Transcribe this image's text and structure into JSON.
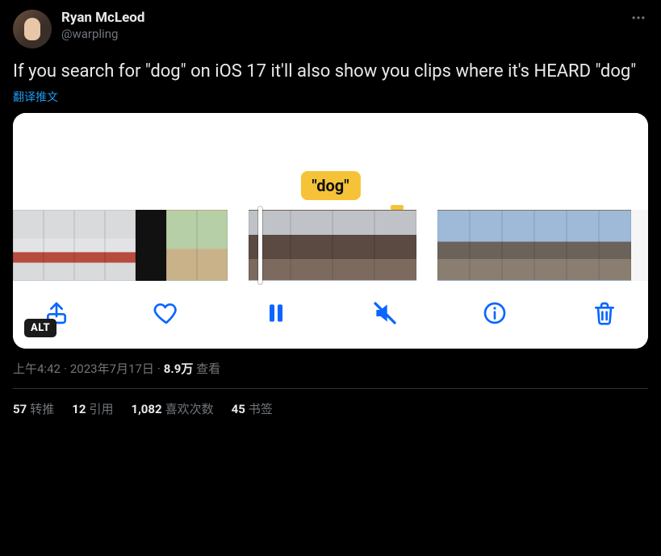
{
  "author": {
    "display_name": "Ryan McLeod",
    "handle": "@warpling"
  },
  "tweet_text": "If you search for \"dog\" on iOS 17 it'll also show you clips where it's HEARD \"dog\"",
  "translate_label": "翻译推文",
  "media": {
    "bubble_text": "\"dog\"",
    "alt_badge": "ALT",
    "controls": [
      "share",
      "like",
      "pause",
      "mute",
      "info",
      "delete"
    ]
  },
  "meta": {
    "time": "上午4:42",
    "date": "2023年7月17日",
    "views_count": "8.9万",
    "views_label": "查看"
  },
  "stats": {
    "retweets": {
      "count": "57",
      "label": "转推"
    },
    "quotes": {
      "count": "12",
      "label": "引用"
    },
    "likes": {
      "count": "1,082",
      "label": "喜欢次数"
    },
    "bookmarks": {
      "count": "45",
      "label": "书签"
    }
  }
}
